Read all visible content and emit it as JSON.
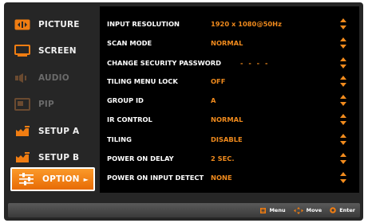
{
  "sidebar": {
    "items": [
      {
        "label": "PICTURE",
        "icon": "picture-icon",
        "state": "normal"
      },
      {
        "label": "SCREEN",
        "icon": "monitor-icon",
        "state": "normal"
      },
      {
        "label": "AUDIO",
        "icon": "speaker-icon",
        "state": "disabled"
      },
      {
        "label": "PIP",
        "icon": "pip-icon",
        "state": "disabled"
      },
      {
        "label": "SETUP A",
        "icon": "setup-a-icon",
        "state": "normal"
      },
      {
        "label": "SETUP B",
        "icon": "setup-b-icon",
        "state": "normal"
      },
      {
        "label": "OPTION",
        "icon": "sliders-icon",
        "state": "selected",
        "arrow": "►"
      }
    ]
  },
  "settings": {
    "rows": [
      {
        "label": "INPUT RESOLUTION",
        "value": "1920 x 1080@50Hz"
      },
      {
        "label": "SCAN MODE",
        "value": "NORMAL"
      },
      {
        "label": "CHANGE SECURITY PASSWORD",
        "value": "- - - -"
      },
      {
        "label": "TILING MENU LOCK",
        "value": "OFF"
      },
      {
        "label": "GROUP ID",
        "value": "A"
      },
      {
        "label": "IR CONTROL",
        "value": "NORMAL"
      },
      {
        "label": "TILING",
        "value": "DISABLE"
      },
      {
        "label": "POWER ON DELAY",
        "value": "2 SEC."
      },
      {
        "label": "POWER ON INPUT DETECT",
        "value": "NONE"
      }
    ]
  },
  "footer": {
    "hints": [
      {
        "label": "Menu",
        "icon": "menu-icon"
      },
      {
        "label": "Move",
        "icon": "move-arrows-icon"
      },
      {
        "label": "Enter",
        "icon": "enter-icon"
      }
    ]
  },
  "colors": {
    "accent": "#f18b1d",
    "selected_bg": "#f08a1a",
    "icon_orange": "#f07d12",
    "background": "#000000",
    "frame": "#262626"
  }
}
